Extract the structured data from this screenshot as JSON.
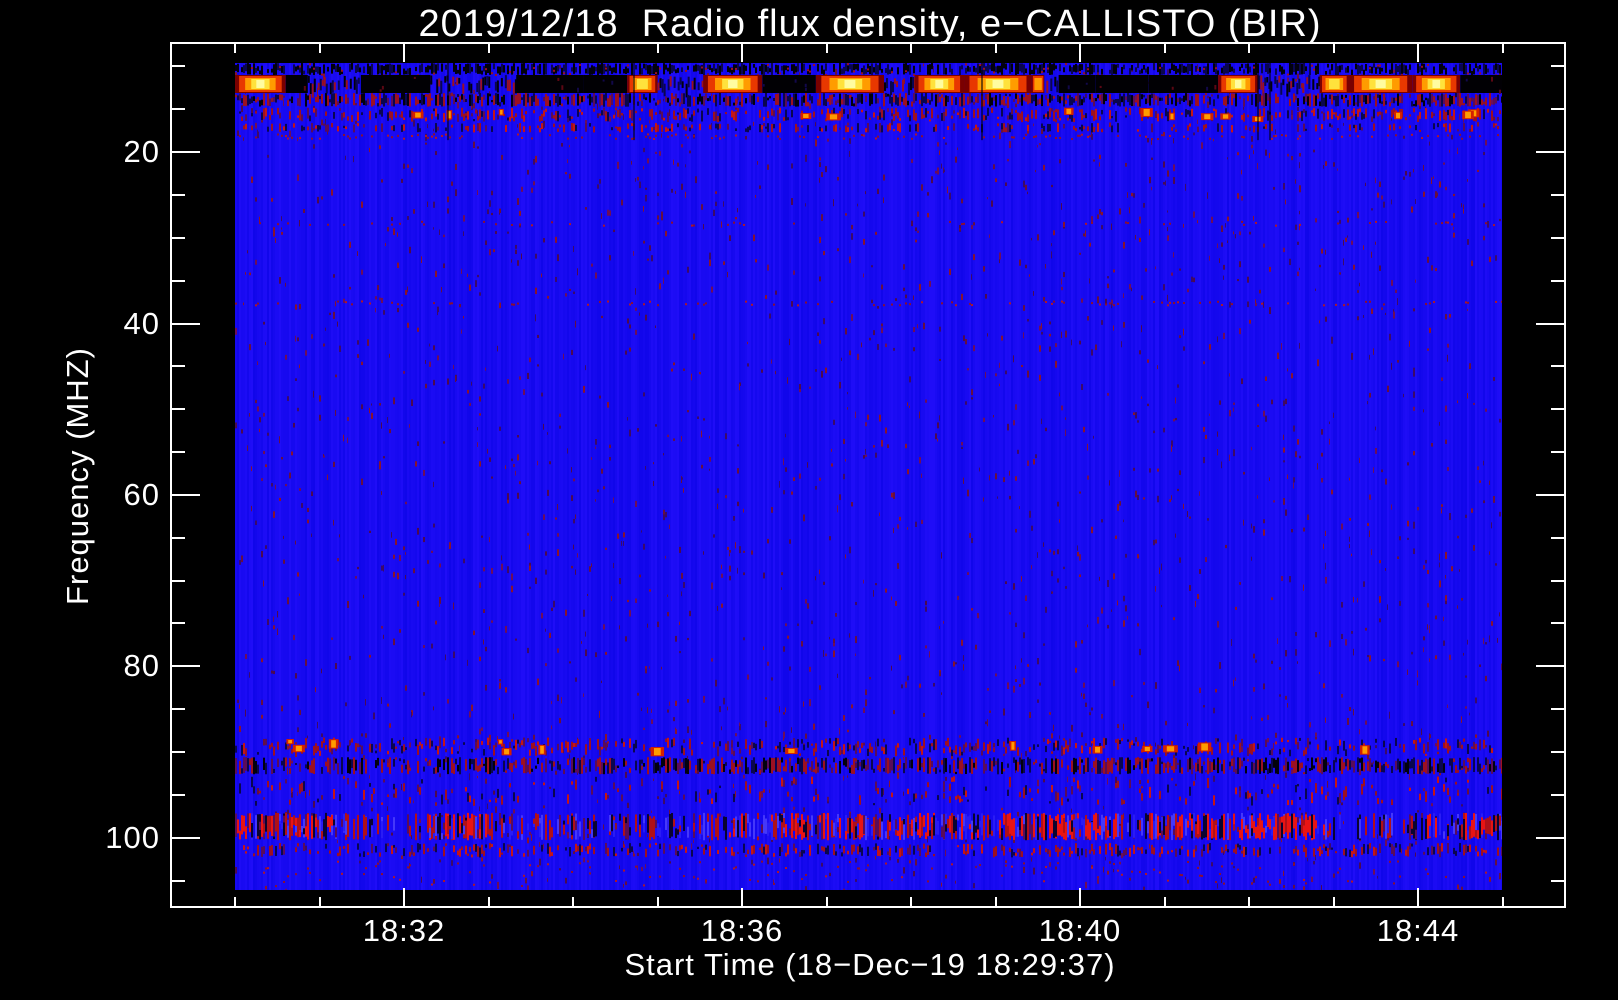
{
  "chart_data": {
    "type": "heatmap",
    "title": "2019/12/18  Radio flux density, e−CALLISTO (BIR)",
    "xlabel": "Start Time (18−Dec−19 18:29:37)",
    "ylabel": "Frequency (MHZ)",
    "date": "2019/12/18",
    "instrument": "e-CALLISTO",
    "station": "BIR",
    "start_time": "18:29:37",
    "x_time_range": [
      "18:30",
      "18:45"
    ],
    "x_ticks_major": [
      {
        "label": "18:32",
        "minute": 2
      },
      {
        "label": "18:36",
        "minute": 6
      },
      {
        "label": "18:40",
        "minute": 10
      },
      {
        "label": "18:44",
        "minute": 14
      }
    ],
    "x_minor_tick_every_min": 1,
    "x_total_minutes": 15,
    "y_ticks_major": [
      20,
      40,
      60,
      80,
      100
    ],
    "y_minor_tick_every_mhz": 5,
    "y_minor_tick_range": [
      10,
      105
    ],
    "freq_range_mhz": [
      9.6,
      106.1
    ],
    "y_axis_inverted": true,
    "grid": false,
    "legend": "none",
    "colormap_description": "e-CALLISTO standard: quiet background saturated blue, interference dark/red/orange/yellow",
    "background_description": "uniform quiet blue background with very sparse faint dark-purple noise dashes",
    "palette": {
      "figure_background": "#000000",
      "axis_color": "#ffffff",
      "base_blue": "#140af0",
      "dark_streak": "#02010e",
      "navy_streak": "#0a0650",
      "speckle_red": "#9c1022",
      "bright_red": "#e81414",
      "purple": "#5a0c5a",
      "burst_orange": "#ff9c00",
      "burst_yellow": "#ffe23c",
      "burst_core": "#fffca0"
    },
    "rfi_bands": [
      {
        "freq_mhz": [
          9.6,
          11.0
        ],
        "intensity": "medium",
        "pattern": "dark-streaks",
        "note": "noisy upper edge band"
      },
      {
        "freq_mhz": [
          11.0,
          13.1
        ],
        "intensity": "strong",
        "pattern": "bright-bursts",
        "note": "intermittent saturated yellow/orange RFI bursts alternating with black dropouts"
      },
      {
        "freq_mhz": [
          13.1,
          14.7
        ],
        "intensity": "medium",
        "pattern": "streaks"
      },
      {
        "freq_mhz": [
          14.8,
          16.5
        ],
        "intensity": "medium",
        "pattern": "speckle-with-bright-spots"
      },
      {
        "freq_mhz": [
          16.6,
          17.7
        ],
        "intensity": "weak",
        "pattern": "speckle"
      },
      {
        "freq_mhz": [
          17.8,
          18.6
        ],
        "intensity": "weak",
        "pattern": "dots"
      },
      {
        "freq_mhz": [
          28.0,
          28.7
        ],
        "intensity": "faint",
        "pattern": "dots"
      },
      {
        "freq_mhz": [
          37.3,
          38.0
        ],
        "intensity": "faint",
        "pattern": "dots"
      },
      {
        "freq_mhz": [
          88.3,
          90.5
        ],
        "intensity": "medium",
        "pattern": "speckle-with-bright-spots",
        "note": "FM broadcast band interference"
      },
      {
        "freq_mhz": [
          90.6,
          92.6
        ],
        "intensity": "medium",
        "pattern": "streaks"
      },
      {
        "freq_mhz": [
          92.8,
          96.3
        ],
        "intensity": "weak",
        "pattern": "speckle"
      },
      {
        "freq_mhz": [
          97.1,
          100.3
        ],
        "intensity": "strong",
        "pattern": "red-bursts",
        "note": "brightest bottom interference band"
      },
      {
        "freq_mhz": [
          100.6,
          102.3
        ],
        "intensity": "medium",
        "pattern": "speckle"
      },
      {
        "freq_mhz": [
          102.6,
          105.8
        ],
        "intensity": "weak",
        "pattern": "dots"
      }
    ]
  }
}
